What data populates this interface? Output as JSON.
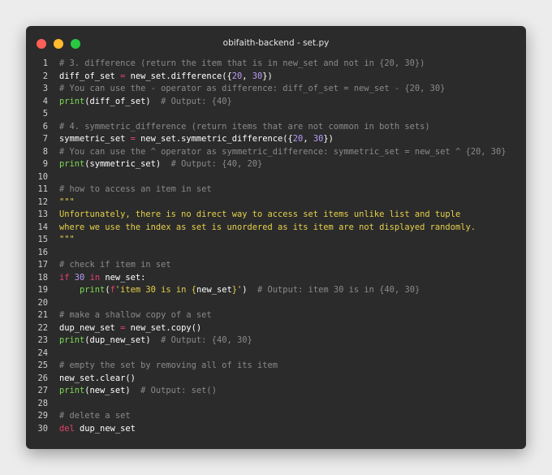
{
  "window": {
    "title": "obifaith-backend - set.py",
    "controls": {
      "close_color": "#ff5f57",
      "minimize_color": "#febc2e",
      "maximize_color": "#28c840"
    }
  },
  "code_lines": [
    {
      "n": "1",
      "tokens": [
        {
          "t": "# 3. difference (return the item that is in new_set and not in {20, 30})",
          "c": "cm"
        }
      ]
    },
    {
      "n": "2",
      "tokens": [
        {
          "t": "diff_of_set ",
          "c": "plain"
        },
        {
          "t": "=",
          "c": "op"
        },
        {
          "t": " new_set.difference({",
          "c": "plain"
        },
        {
          "t": "20",
          "c": "num"
        },
        {
          "t": ", ",
          "c": "plain"
        },
        {
          "t": "30",
          "c": "num"
        },
        {
          "t": "})",
          "c": "plain"
        }
      ]
    },
    {
      "n": "3",
      "tokens": [
        {
          "t": "# You can use the - operator as difference: diff_of_set = new_set - {20, 30}",
          "c": "cm"
        }
      ]
    },
    {
      "n": "4",
      "tokens": [
        {
          "t": "print",
          "c": "fn"
        },
        {
          "t": "(diff_of_set)  ",
          "c": "plain"
        },
        {
          "t": "# Output: {40}",
          "c": "cm"
        }
      ]
    },
    {
      "n": "5",
      "tokens": []
    },
    {
      "n": "6",
      "tokens": [
        {
          "t": "# 4. symmetric_difference (return items that are not common in both sets)",
          "c": "cm"
        }
      ]
    },
    {
      "n": "7",
      "tokens": [
        {
          "t": "symmetric_set ",
          "c": "plain"
        },
        {
          "t": "=",
          "c": "op"
        },
        {
          "t": " new_set.symmetric_difference({",
          "c": "plain"
        },
        {
          "t": "20",
          "c": "num"
        },
        {
          "t": ", ",
          "c": "plain"
        },
        {
          "t": "30",
          "c": "num"
        },
        {
          "t": "})",
          "c": "plain"
        }
      ]
    },
    {
      "n": "8",
      "tokens": [
        {
          "t": "# You can use the ^ operator as symmetric_difference: symmetric_set = new_set ^ {20, 30}",
          "c": "cm"
        }
      ]
    },
    {
      "n": "9",
      "tokens": [
        {
          "t": "print",
          "c": "fn"
        },
        {
          "t": "(symmetric_set)  ",
          "c": "plain"
        },
        {
          "t": "# Output: {40, 20}",
          "c": "cm"
        }
      ]
    },
    {
      "n": "10",
      "tokens": []
    },
    {
      "n": "11",
      "tokens": [
        {
          "t": "# how to access an item in set",
          "c": "cm"
        }
      ]
    },
    {
      "n": "12",
      "tokens": [
        {
          "t": "\"\"\"",
          "c": "str"
        }
      ]
    },
    {
      "n": "13",
      "tokens": [
        {
          "t": "Unfortunately, there is no direct way to access set items unlike list and tuple",
          "c": "str"
        }
      ]
    },
    {
      "n": "14",
      "tokens": [
        {
          "t": "where we use the index as set is unordered as its item are not displayed randomly.",
          "c": "str"
        }
      ]
    },
    {
      "n": "15",
      "tokens": [
        {
          "t": "\"\"\"",
          "c": "str"
        }
      ]
    },
    {
      "n": "16",
      "tokens": []
    },
    {
      "n": "17",
      "tokens": [
        {
          "t": "# check if item in set",
          "c": "cm"
        }
      ]
    },
    {
      "n": "18",
      "tokens": [
        {
          "t": "if",
          "c": "kw"
        },
        {
          "t": " ",
          "c": "plain"
        },
        {
          "t": "30",
          "c": "num"
        },
        {
          "t": " ",
          "c": "plain"
        },
        {
          "t": "in",
          "c": "kw"
        },
        {
          "t": " new_set:",
          "c": "plain"
        }
      ]
    },
    {
      "n": "19",
      "tokens": [
        {
          "t": "    ",
          "c": "plain"
        },
        {
          "t": "print",
          "c": "fn"
        },
        {
          "t": "(",
          "c": "plain"
        },
        {
          "t": "f",
          "c": "kw"
        },
        {
          "t": "'item 30 is in {",
          "c": "str"
        },
        {
          "t": "new_set",
          "c": "plain"
        },
        {
          "t": "}'",
          "c": "str"
        },
        {
          "t": ")  ",
          "c": "plain"
        },
        {
          "t": "# Output: item 30 is in {40, 30}",
          "c": "cm"
        }
      ]
    },
    {
      "n": "20",
      "tokens": []
    },
    {
      "n": "21",
      "tokens": [
        {
          "t": "# make a shallow copy of a set",
          "c": "cm"
        }
      ]
    },
    {
      "n": "22",
      "tokens": [
        {
          "t": "dup_new_set ",
          "c": "plain"
        },
        {
          "t": "=",
          "c": "op"
        },
        {
          "t": " new_set.copy()",
          "c": "plain"
        }
      ]
    },
    {
      "n": "23",
      "tokens": [
        {
          "t": "print",
          "c": "fn"
        },
        {
          "t": "(dup_new_set)  ",
          "c": "plain"
        },
        {
          "t": "# Output: {40, 30}",
          "c": "cm"
        }
      ]
    },
    {
      "n": "24",
      "tokens": []
    },
    {
      "n": "25",
      "tokens": [
        {
          "t": "# empty the set by removing all of its item",
          "c": "cm"
        }
      ]
    },
    {
      "n": "26",
      "tokens": [
        {
          "t": "new_set.clear()",
          "c": "plain"
        }
      ]
    },
    {
      "n": "27",
      "tokens": [
        {
          "t": "print",
          "c": "fn"
        },
        {
          "t": "(new_set)  ",
          "c": "plain"
        },
        {
          "t": "# Output: set()",
          "c": "cm"
        }
      ]
    },
    {
      "n": "28",
      "tokens": []
    },
    {
      "n": "29",
      "tokens": [
        {
          "t": "# delete a set",
          "c": "cm"
        }
      ]
    },
    {
      "n": "30",
      "tokens": [
        {
          "t": "del",
          "c": "kw"
        },
        {
          "t": " dup_new_set",
          "c": "plain"
        }
      ]
    }
  ]
}
